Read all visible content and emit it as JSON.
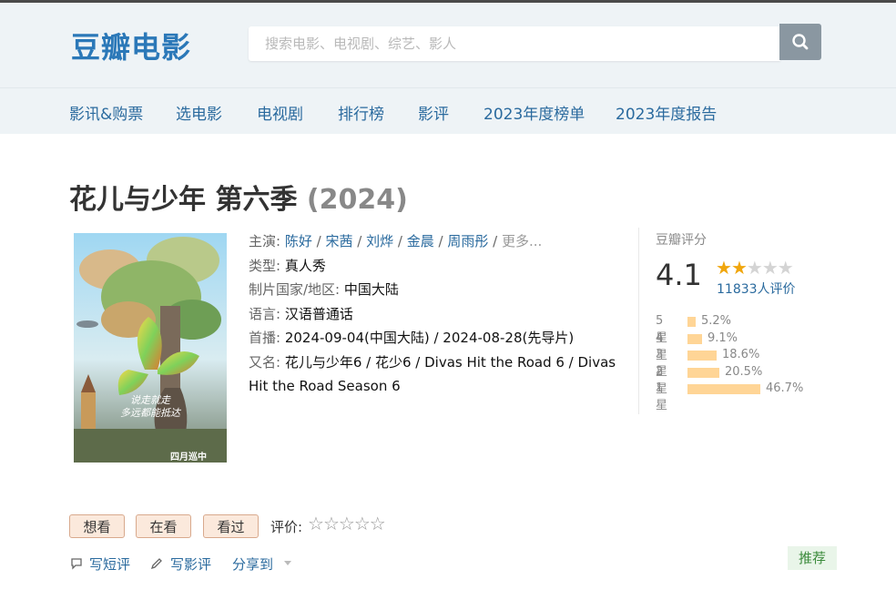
{
  "header": {
    "logo_text": "豆瓣电影",
    "search_placeholder": "搜索电影、电视剧、综艺、影人"
  },
  "nav": {
    "items": [
      "影讯&购票",
      "选电影",
      "电视剧",
      "排行榜",
      "影评",
      "2023年度榜单",
      "2023年度报告"
    ]
  },
  "title": {
    "name": "花儿与少年 第六季",
    "year": "(2024)"
  },
  "info": {
    "cast_label": "主演:",
    "cast": [
      "陈好",
      "宋茜",
      "刘烨",
      "金晨",
      "周雨彤"
    ],
    "cast_more": "更多...",
    "genre_label": "类型:",
    "genre": "真人秀",
    "country_label": "制片国家/地区:",
    "country": "中国大陆",
    "language_label": "语言:",
    "language": "汉语普通话",
    "premiere_label": "首播:",
    "premiere": "2024-09-04(中国大陆) / 2024-08-28(先导片)",
    "aka_label": "又名:",
    "aka": "花儿与少年6 / 花少6 / Divas Hit the Road 6 / Divas Hit the Road Season 6"
  },
  "rating": {
    "label": "豆瓣评分",
    "score": "4.1",
    "star_level": 2,
    "votes": "11833人评价",
    "distribution": [
      {
        "label": "5星",
        "percent_text": "5.2%",
        "percent": 5.2
      },
      {
        "label": "4星",
        "percent_text": "9.1%",
        "percent": 9.1
      },
      {
        "label": "3星",
        "percent_text": "18.6%",
        "percent": 18.6
      },
      {
        "label": "2星",
        "percent_text": "20.5%",
        "percent": 20.5
      },
      {
        "label": "1星",
        "percent_text": "46.7%",
        "percent": 46.7
      }
    ]
  },
  "actions": {
    "want_label": "想看",
    "watching_label": "在看",
    "watched_label": "看过",
    "rate_label": "评价:",
    "short_review": "写短评",
    "review": "写影评",
    "share": "分享到",
    "recommend": "推荐"
  },
  "poster": {
    "text_line1": "说走就走",
    "text_line2": "多远都能抵达",
    "text_bottom": "四月巡中"
  },
  "colors": {
    "accent": "#2a6a9e",
    "logo": "#2b78b8",
    "star": "#f0a60d",
    "bar": "#ffd596"
  }
}
